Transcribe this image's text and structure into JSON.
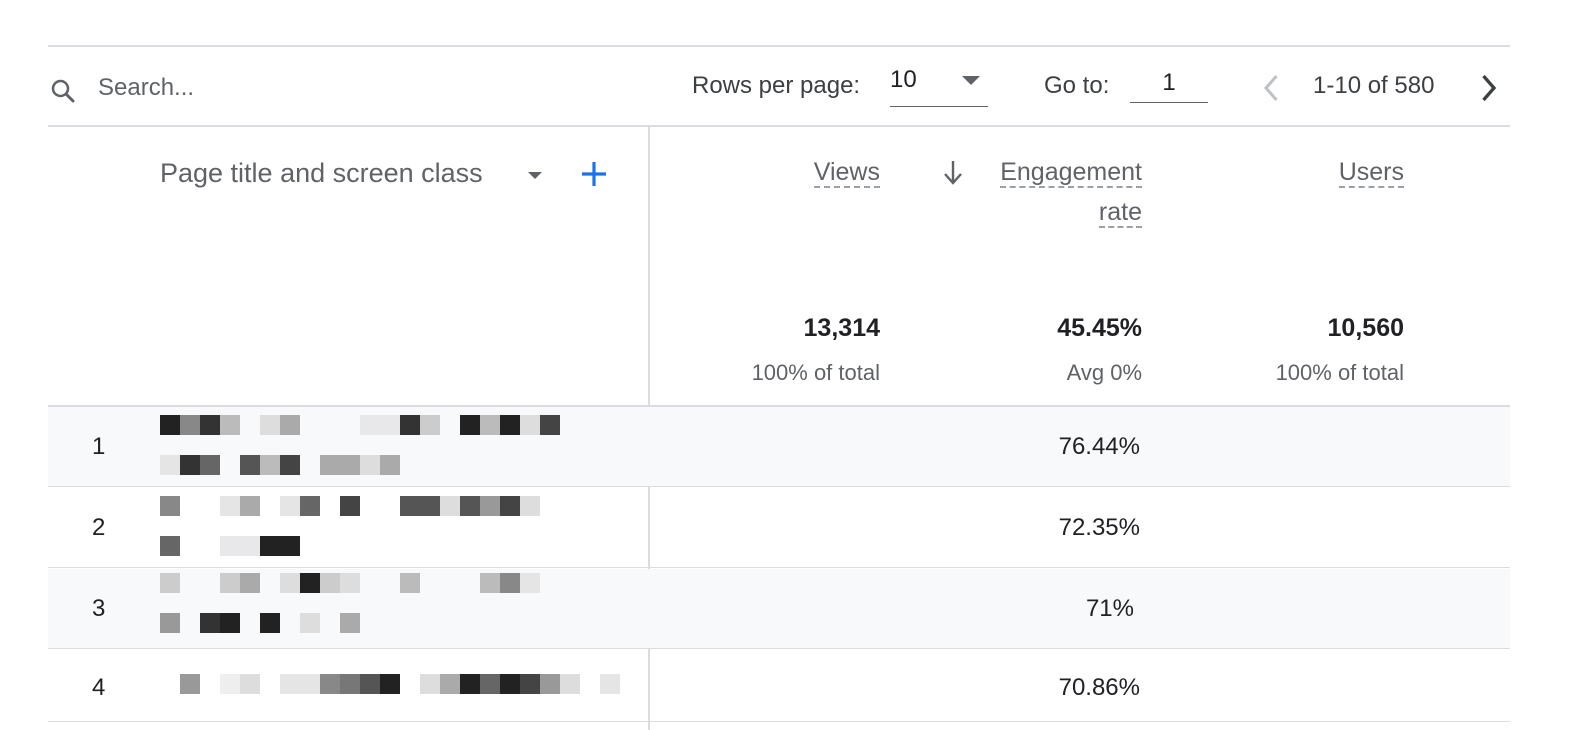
{
  "toolbar": {
    "search_placeholder": "Search...",
    "rows_per_page_label": "Rows per page:",
    "rows_per_page_value": "10",
    "goto_label": "Go to:",
    "goto_value": "1",
    "range_text": "1-10 of 580"
  },
  "table": {
    "dimension_header": "Page title and screen class",
    "columns": [
      {
        "label": "Views",
        "total": "13,314",
        "sub": "100% of total"
      },
      {
        "label_line1": "Engagement",
        "label_line2": "rate",
        "total": "45.45%",
        "sub": "Avg 0%",
        "sorted": "descending"
      },
      {
        "label": "Users",
        "total": "10,560",
        "sub": "100% of total"
      }
    ],
    "rows": [
      {
        "index": "1",
        "engagement_rate": "76.44%"
      },
      {
        "index": "2",
        "engagement_rate": "72.35%"
      },
      {
        "index": "3",
        "engagement_rate": "71%"
      },
      {
        "index": "4",
        "engagement_rate": "70.86%"
      }
    ]
  },
  "colors": {
    "accent": "#1a73e8",
    "divider": "#dadce0",
    "row_alt_bg": "#f8f9fa"
  },
  "icons": [
    "search-icon",
    "chevron-down-icon",
    "add-icon",
    "chevron-left-icon",
    "chevron-right-icon",
    "arrow-down-icon"
  ]
}
